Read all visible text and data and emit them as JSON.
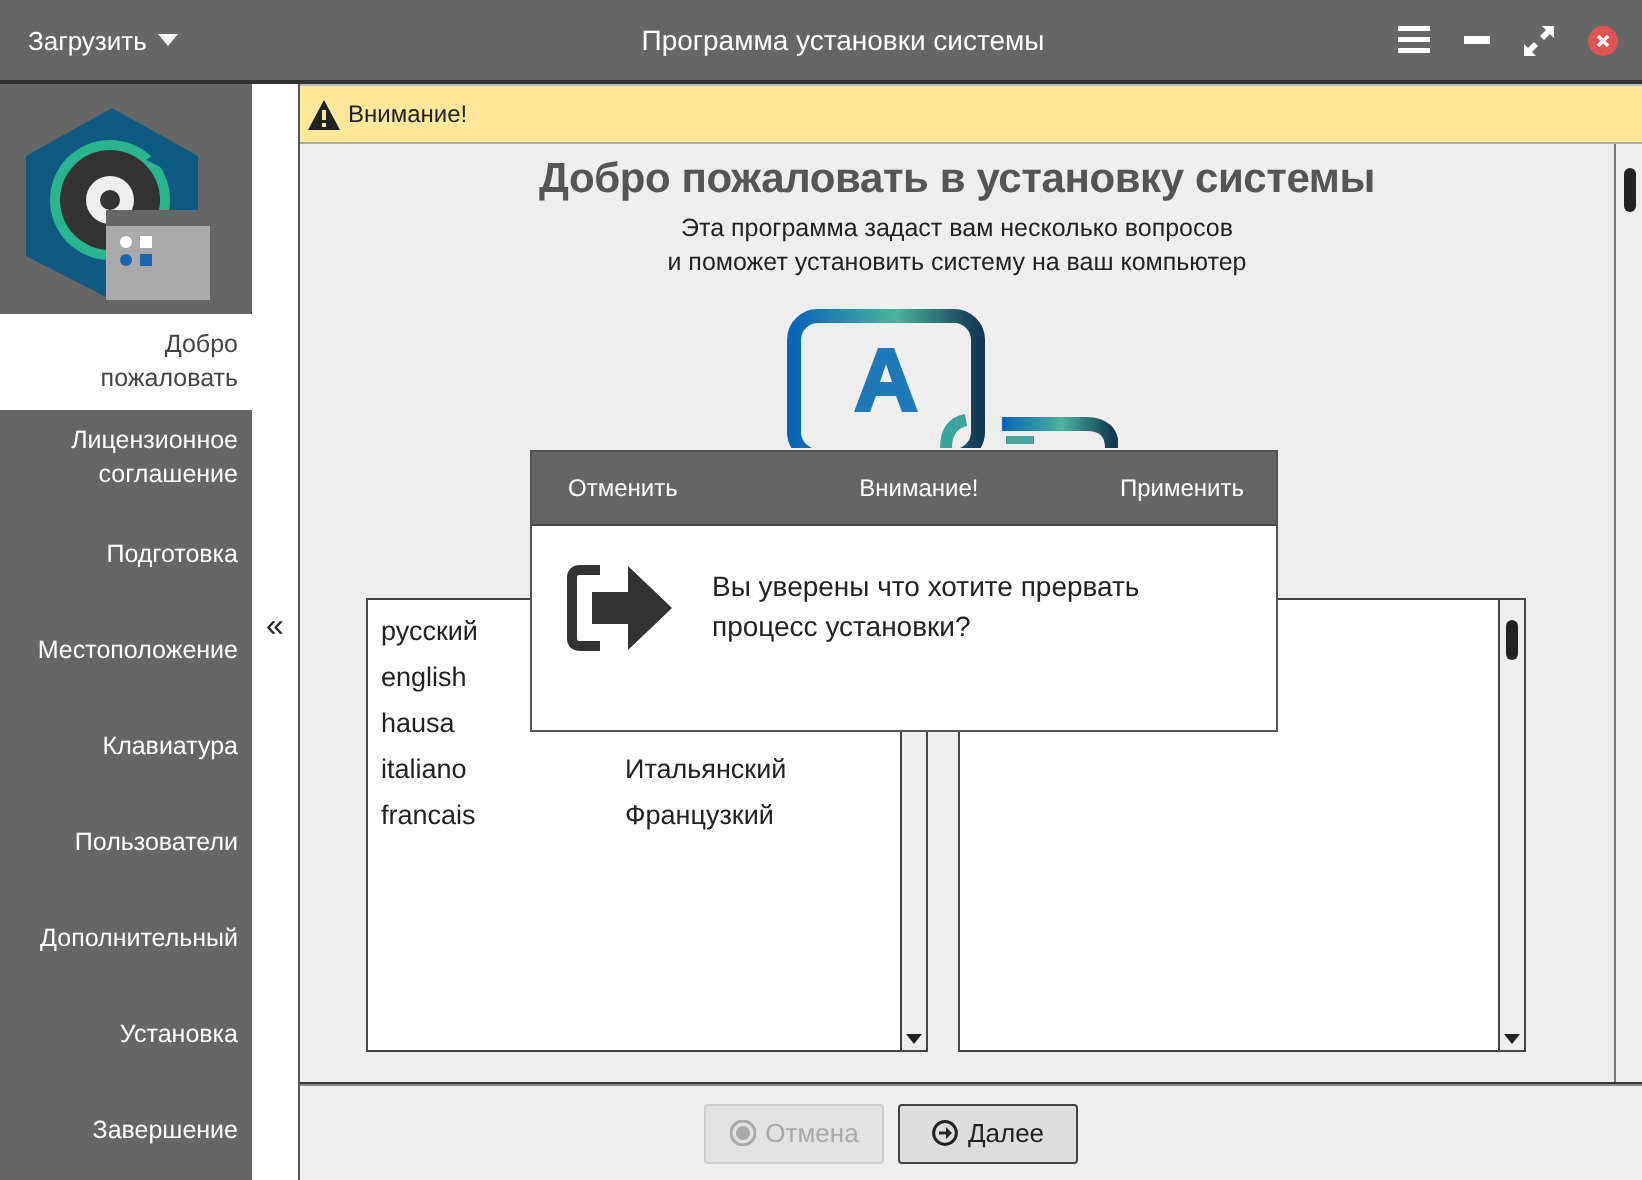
{
  "window": {
    "menu_button": "Загрузить",
    "title": "Программа установки системы"
  },
  "sidebar": {
    "items": [
      {
        "label": "Добро\nпожаловать",
        "selected": true
      },
      {
        "label": "Лицензионное\nсоглашение",
        "selected": false
      },
      {
        "label": "Подготовка",
        "selected": false
      },
      {
        "label": "Местоположение",
        "selected": false
      },
      {
        "label": "Клавиатура",
        "selected": false
      },
      {
        "label": "Пользователи",
        "selected": false
      },
      {
        "label": "Дополнительный",
        "selected": false
      },
      {
        "label": "Установка",
        "selected": false
      },
      {
        "label": "Завершение",
        "selected": false
      }
    ],
    "collapse": "«"
  },
  "warning": {
    "text": "Внимание!"
  },
  "welcome": {
    "title": "Добро пожаловать в установку системы",
    "subtitle": "Эта программа задаст вам несколько вопросов\nи поможет установить систему на ваш компьютер"
  },
  "languages": [
    {
      "native": "русский"
    },
    {
      "native": "english"
    },
    {
      "native": "hausa"
    },
    {
      "native": "italiano",
      "translation": "Итальянский"
    },
    {
      "native": "francais",
      "translation": "Французкий"
    }
  ],
  "buttons": [
    {
      "kind": "cancel",
      "label": "Отмена",
      "disabled": true
    },
    {
      "kind": "next",
      "label": "Далее",
      "disabled": false
    }
  ],
  "dialog": {
    "cancel": "Отменить",
    "title": "Внимание!",
    "apply": "Применить",
    "message": "Вы уверены что хотите прервать процесс установки?"
  }
}
